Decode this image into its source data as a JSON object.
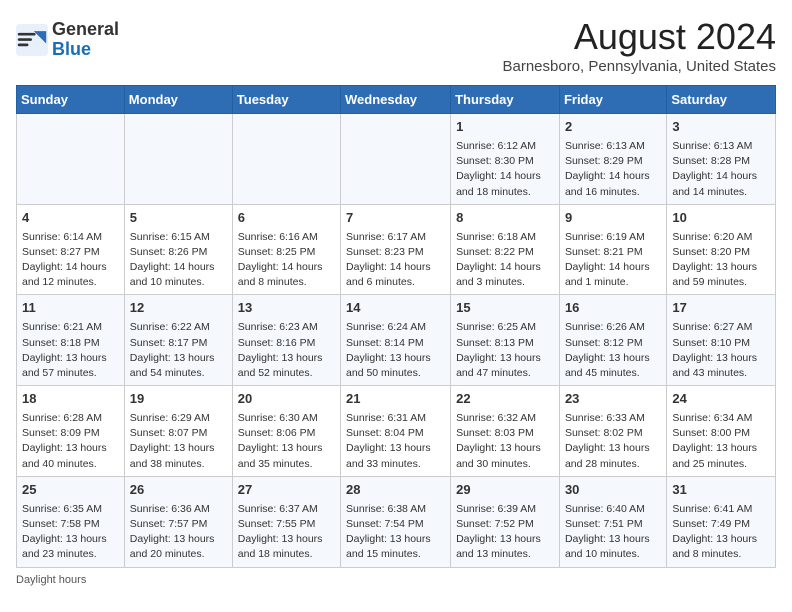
{
  "logo": {
    "general": "General",
    "blue": "Blue"
  },
  "title": "August 2024",
  "subtitle": "Barnesboro, Pennsylvania, United States",
  "days_of_week": [
    "Sunday",
    "Monday",
    "Tuesday",
    "Wednesday",
    "Thursday",
    "Friday",
    "Saturday"
  ],
  "weeks": [
    [
      {
        "day": "",
        "info": ""
      },
      {
        "day": "",
        "info": ""
      },
      {
        "day": "",
        "info": ""
      },
      {
        "day": "",
        "info": ""
      },
      {
        "day": "1",
        "info": "Sunrise: 6:12 AM\nSunset: 8:30 PM\nDaylight: 14 hours\nand 18 minutes."
      },
      {
        "day": "2",
        "info": "Sunrise: 6:13 AM\nSunset: 8:29 PM\nDaylight: 14 hours\nand 16 minutes."
      },
      {
        "day": "3",
        "info": "Sunrise: 6:13 AM\nSunset: 8:28 PM\nDaylight: 14 hours\nand 14 minutes."
      }
    ],
    [
      {
        "day": "4",
        "info": "Sunrise: 6:14 AM\nSunset: 8:27 PM\nDaylight: 14 hours\nand 12 minutes."
      },
      {
        "day": "5",
        "info": "Sunrise: 6:15 AM\nSunset: 8:26 PM\nDaylight: 14 hours\nand 10 minutes."
      },
      {
        "day": "6",
        "info": "Sunrise: 6:16 AM\nSunset: 8:25 PM\nDaylight: 14 hours\nand 8 minutes."
      },
      {
        "day": "7",
        "info": "Sunrise: 6:17 AM\nSunset: 8:23 PM\nDaylight: 14 hours\nand 6 minutes."
      },
      {
        "day": "8",
        "info": "Sunrise: 6:18 AM\nSunset: 8:22 PM\nDaylight: 14 hours\nand 3 minutes."
      },
      {
        "day": "9",
        "info": "Sunrise: 6:19 AM\nSunset: 8:21 PM\nDaylight: 14 hours\nand 1 minute."
      },
      {
        "day": "10",
        "info": "Sunrise: 6:20 AM\nSunset: 8:20 PM\nDaylight: 13 hours\nand 59 minutes."
      }
    ],
    [
      {
        "day": "11",
        "info": "Sunrise: 6:21 AM\nSunset: 8:18 PM\nDaylight: 13 hours\nand 57 minutes."
      },
      {
        "day": "12",
        "info": "Sunrise: 6:22 AM\nSunset: 8:17 PM\nDaylight: 13 hours\nand 54 minutes."
      },
      {
        "day": "13",
        "info": "Sunrise: 6:23 AM\nSunset: 8:16 PM\nDaylight: 13 hours\nand 52 minutes."
      },
      {
        "day": "14",
        "info": "Sunrise: 6:24 AM\nSunset: 8:14 PM\nDaylight: 13 hours\nand 50 minutes."
      },
      {
        "day": "15",
        "info": "Sunrise: 6:25 AM\nSunset: 8:13 PM\nDaylight: 13 hours\nand 47 minutes."
      },
      {
        "day": "16",
        "info": "Sunrise: 6:26 AM\nSunset: 8:12 PM\nDaylight: 13 hours\nand 45 minutes."
      },
      {
        "day": "17",
        "info": "Sunrise: 6:27 AM\nSunset: 8:10 PM\nDaylight: 13 hours\nand 43 minutes."
      }
    ],
    [
      {
        "day": "18",
        "info": "Sunrise: 6:28 AM\nSunset: 8:09 PM\nDaylight: 13 hours\nand 40 minutes."
      },
      {
        "day": "19",
        "info": "Sunrise: 6:29 AM\nSunset: 8:07 PM\nDaylight: 13 hours\nand 38 minutes."
      },
      {
        "day": "20",
        "info": "Sunrise: 6:30 AM\nSunset: 8:06 PM\nDaylight: 13 hours\nand 35 minutes."
      },
      {
        "day": "21",
        "info": "Sunrise: 6:31 AM\nSunset: 8:04 PM\nDaylight: 13 hours\nand 33 minutes."
      },
      {
        "day": "22",
        "info": "Sunrise: 6:32 AM\nSunset: 8:03 PM\nDaylight: 13 hours\nand 30 minutes."
      },
      {
        "day": "23",
        "info": "Sunrise: 6:33 AM\nSunset: 8:02 PM\nDaylight: 13 hours\nand 28 minutes."
      },
      {
        "day": "24",
        "info": "Sunrise: 6:34 AM\nSunset: 8:00 PM\nDaylight: 13 hours\nand 25 minutes."
      }
    ],
    [
      {
        "day": "25",
        "info": "Sunrise: 6:35 AM\nSunset: 7:58 PM\nDaylight: 13 hours\nand 23 minutes."
      },
      {
        "day": "26",
        "info": "Sunrise: 6:36 AM\nSunset: 7:57 PM\nDaylight: 13 hours\nand 20 minutes."
      },
      {
        "day": "27",
        "info": "Sunrise: 6:37 AM\nSunset: 7:55 PM\nDaylight: 13 hours\nand 18 minutes."
      },
      {
        "day": "28",
        "info": "Sunrise: 6:38 AM\nSunset: 7:54 PM\nDaylight: 13 hours\nand 15 minutes."
      },
      {
        "day": "29",
        "info": "Sunrise: 6:39 AM\nSunset: 7:52 PM\nDaylight: 13 hours\nand 13 minutes."
      },
      {
        "day": "30",
        "info": "Sunrise: 6:40 AM\nSunset: 7:51 PM\nDaylight: 13 hours\nand 10 minutes."
      },
      {
        "day": "31",
        "info": "Sunrise: 6:41 AM\nSunset: 7:49 PM\nDaylight: 13 hours\nand 8 minutes."
      }
    ]
  ],
  "footer": "Daylight hours"
}
